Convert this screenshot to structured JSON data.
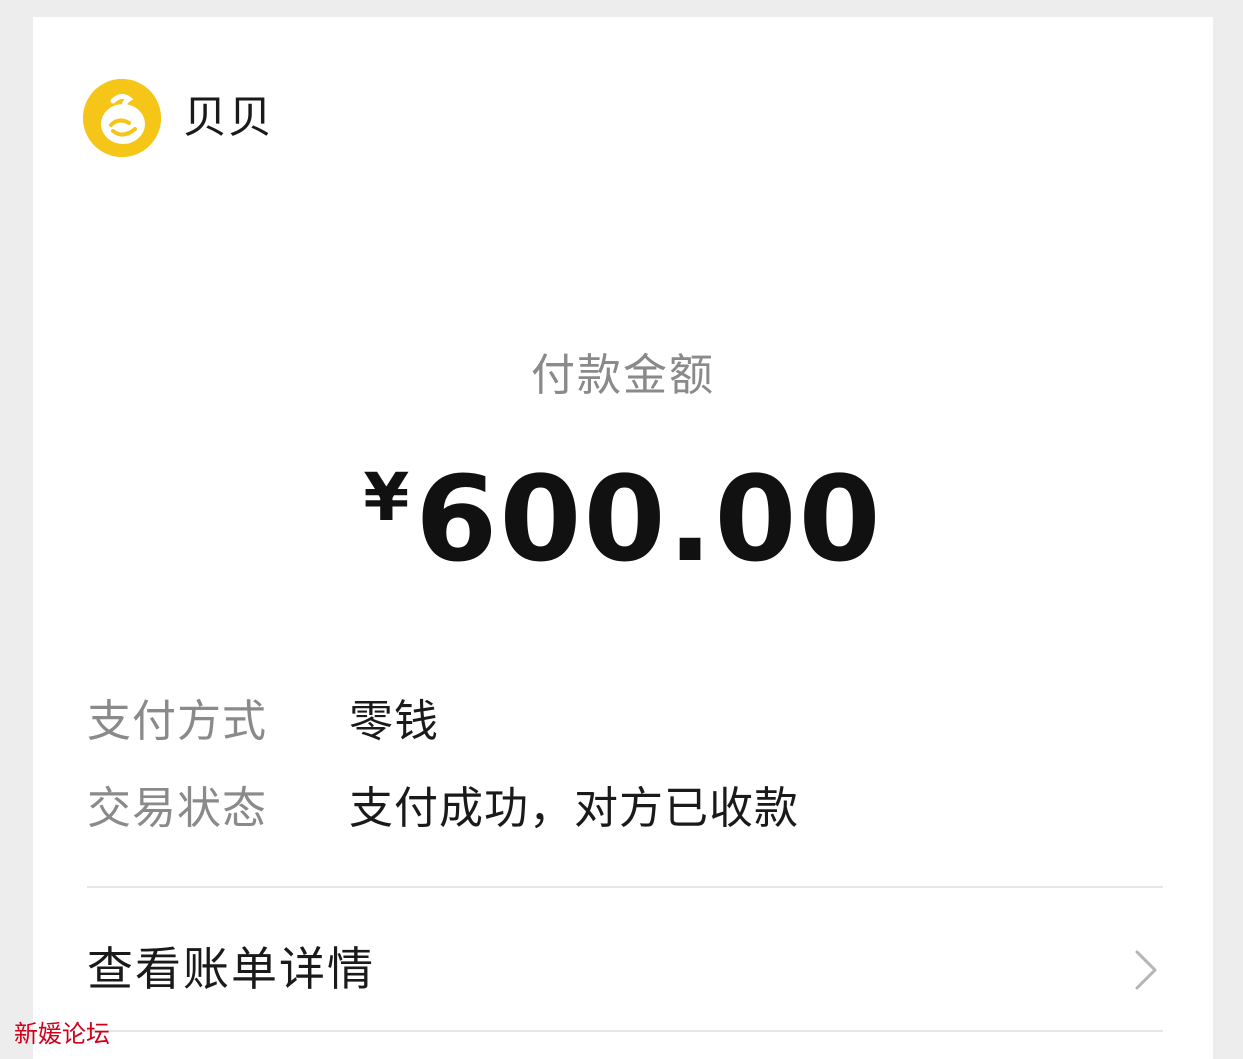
{
  "merchant": {
    "name": "贝贝",
    "logo_icon": "baby-face-icon",
    "logo_color": "#f5c518"
  },
  "payment": {
    "amount_label": "付款金额",
    "currency_symbol": "¥",
    "amount": "600.00"
  },
  "details": [
    {
      "label": "支付方式",
      "value": "零钱"
    },
    {
      "label": "交易状态",
      "value": "支付成功，对方已收款"
    }
  ],
  "bill_link": {
    "label": "查看账单详情",
    "icon": "chevron-right-icon"
  },
  "watermark": "新媛论坛"
}
